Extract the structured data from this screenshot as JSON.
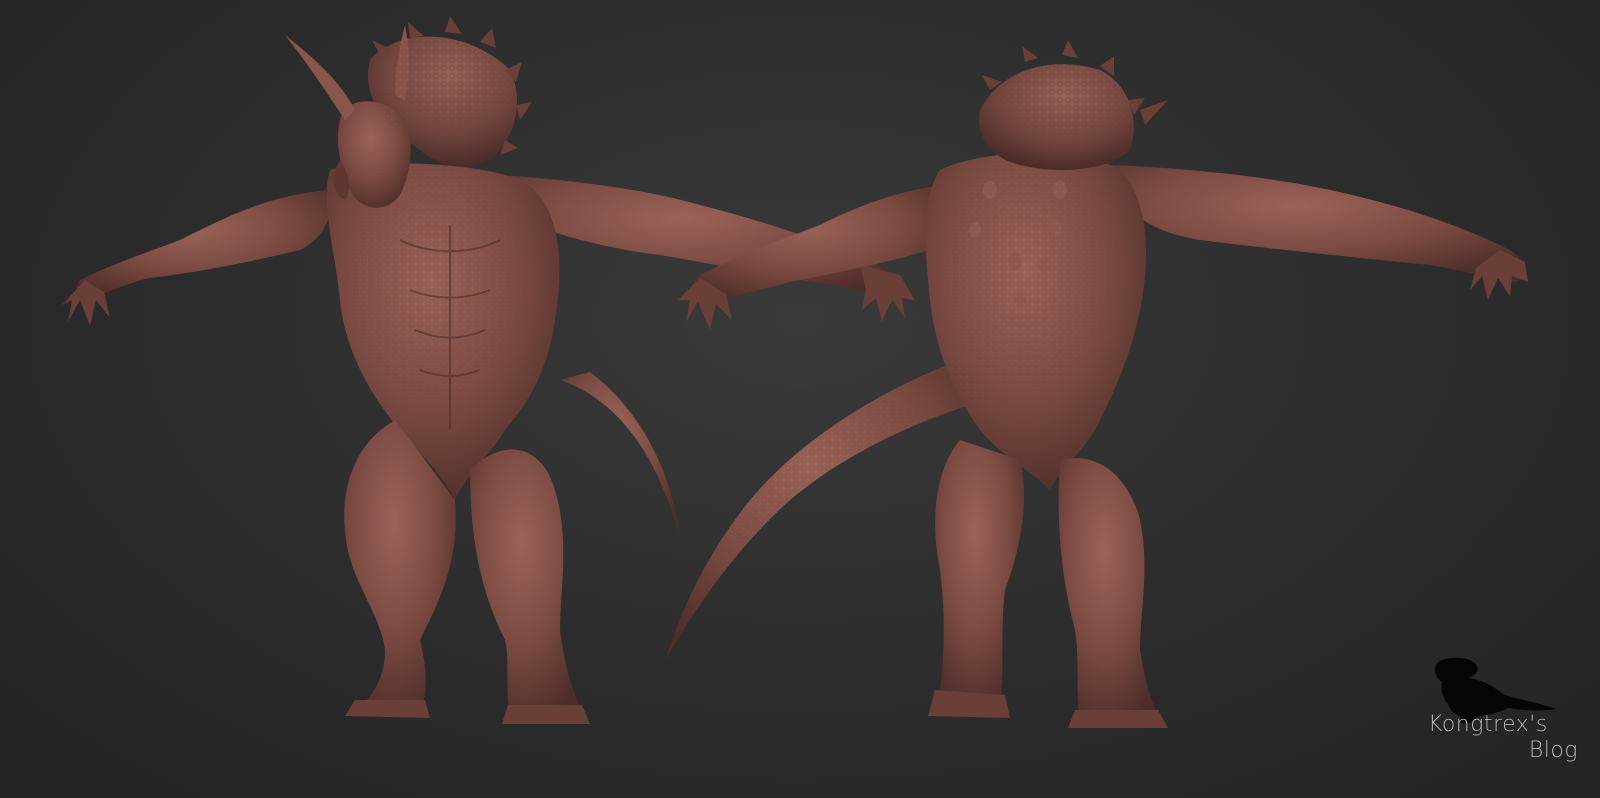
{
  "scene": {
    "background": "#2b2b2b",
    "clay_color": "#7a4a42",
    "clay_dark": "#4e2d28",
    "clay_light": "#9a6358",
    "subjects": [
      {
        "id": "front",
        "icon": "triceratops-creature-front-view"
      },
      {
        "id": "back",
        "icon": "triceratops-creature-back-view"
      }
    ]
  },
  "watermark": {
    "line1": "Kongtrex's",
    "line2": "Blog",
    "icon": "trex-silhouette-logo"
  }
}
